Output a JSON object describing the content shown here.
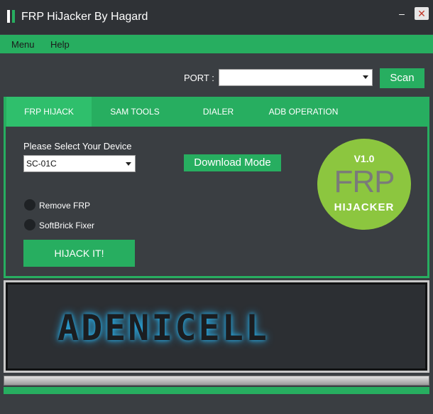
{
  "window": {
    "title": "FRP HiJacker By Hagard",
    "minimize_glyph": "–",
    "close_glyph": "✕"
  },
  "menu": {
    "items": [
      "Menu",
      "Help"
    ]
  },
  "port": {
    "label": "PORT :",
    "value": "",
    "scan_label": "Scan"
  },
  "tabs": [
    {
      "label": "FRP HIJACK",
      "active": true
    },
    {
      "label": "SAM TOOLS",
      "active": false
    },
    {
      "label": "DIALER",
      "active": false
    },
    {
      "label": "ADB OPERATION",
      "active": false
    }
  ],
  "frp_panel": {
    "device_label": "Please Select Your Device",
    "device_value": "SC-01C",
    "download_mode_label": "Download Mode",
    "options": [
      "Remove FRP",
      "SoftBrick Fixer"
    ],
    "hijack_label": "HIJACK IT!"
  },
  "badge": {
    "version": "V1.0",
    "line1": "FRP",
    "line2": "HIJACKER"
  },
  "banner": {
    "text": "ADENICELL"
  },
  "colors": {
    "accent": "#27ae60",
    "background": "#3a3e42",
    "badge": "#8cc63f",
    "glow": "#29a8e0"
  }
}
